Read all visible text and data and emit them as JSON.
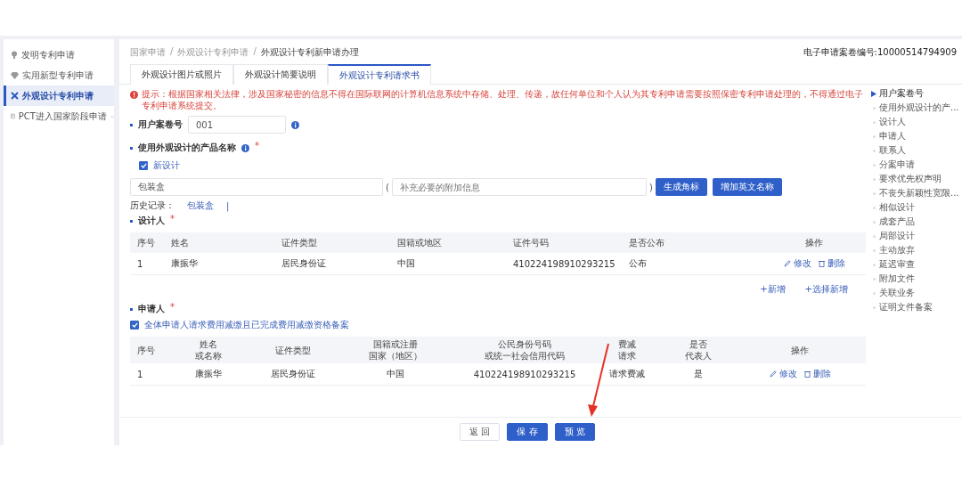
{
  "sidebar": {
    "items": [
      {
        "label": "发明专利申请",
        "selected": false,
        "expandable": false
      },
      {
        "label": "实用新型专利申请",
        "selected": false,
        "expandable": false
      },
      {
        "label": "外观设计专利申请",
        "selected": true,
        "expandable": false
      },
      {
        "label": "PCT进入国家阶段申请",
        "selected": false,
        "expandable": true
      }
    ]
  },
  "breadcrumb": [
    {
      "kind": "link",
      "text": "国家申请"
    },
    {
      "kind": "separator",
      "text": "/"
    },
    {
      "kind": "link",
      "text": "外观设计专利申请"
    },
    {
      "kind": "separator",
      "text": "/"
    },
    {
      "kind": "current",
      "text": "外观设计专利新申请办理"
    }
  ],
  "case_number": "电子申请案卷编号:10000514794909",
  "tabs": [
    {
      "label": "外观设计图片或照片",
      "selected": false
    },
    {
      "label": "外观设计简要说明",
      "selected": false
    },
    {
      "label": "外观设计专利请求书",
      "selected": true
    }
  ],
  "notice": "提示：根据国家相关法律，涉及国家秘密的信息不得在国际联网的计算机信息系统中存储、处理、传递，故任何单位和个人认为其专利申请需要按照保密专利申请处理的，不得通过电子专利申请系统提交。",
  "user_case": {
    "label": "用户案卷号",
    "value": "001"
  },
  "product": {
    "label": "使用外观设计的产品名称",
    "required": true,
    "required_mark": "*",
    "new_design": {
      "label": "新设计",
      "checked": true
    },
    "name": "包装盒",
    "open_paren": "(",
    "extra_placeholder": "补充必要的附加信息",
    "close_paren": ")",
    "buttons": [
      "生成角标",
      "增加英文名称"
    ],
    "history_label": "历史记录：",
    "history": [
      "包装盒"
    ],
    "history_separator": "|"
  },
  "designers": {
    "title": "设计人",
    "required": true,
    "required_mark": "*",
    "columns": [
      "序号",
      "姓名",
      "证件类型",
      "国籍或地区",
      "证件号码",
      "是否公布",
      "操作"
    ],
    "rows": [
      {
        "cells": [
          "1",
          "康振华",
          "居民身份证",
          "中国",
          "410224198910293215",
          "公布"
        ],
        "actions": [
          {
            "label": "修改",
            "kind": "edit"
          },
          {
            "label": "删除",
            "kind": "delete"
          }
        ]
      }
    ],
    "links": [
      "+新增",
      "+选择新增"
    ]
  },
  "applicants": {
    "title": "申请人",
    "required": true,
    "required_mark": "*",
    "fee_reduction": {
      "label": "全体申请人请求费用减缴且已完成费用减缴资格备案",
      "checked": true
    },
    "columns": [
      "序号",
      [
        "姓名",
        "或名称"
      ],
      "证件类型",
      [
        "国籍或注册",
        "国家（地区）"
      ],
      [
        "公民身份号码",
        "或统一社会信用代码"
      ],
      [
        "费减",
        "请求"
      ],
      [
        "是否",
        "代表人"
      ],
      "操作"
    ],
    "rows": [
      {
        "cells": [
          "1",
          "康振华",
          "居民身份证",
          "中国",
          "410224198910293215",
          "请求费减",
          "是"
        ],
        "actions": [
          {
            "label": "修改",
            "kind": "edit"
          },
          {
            "label": "删除",
            "kind": "delete"
          }
        ]
      }
    ]
  },
  "footer_buttons": [
    {
      "label": "返 回",
      "kind": "plain"
    },
    {
      "label": "保 存",
      "kind": "primary"
    },
    {
      "label": "预 览",
      "kind": "primary"
    }
  ],
  "outline": [
    {
      "label": "用户案卷号",
      "selected": true
    },
    {
      "label": "使用外观设计的产...",
      "selected": false
    },
    {
      "label": "设计人",
      "selected": false
    },
    {
      "label": "申请人",
      "selected": false
    },
    {
      "label": "联系人",
      "selected": false
    },
    {
      "label": "分案申请",
      "selected": false
    },
    {
      "label": "要求优先权声明",
      "selected": false
    },
    {
      "label": "不丧失新颖性宽限...",
      "selected": false
    },
    {
      "label": "相似设计",
      "selected": false
    },
    {
      "label": "成套产品",
      "selected": false
    },
    {
      "label": "局部设计",
      "selected": false
    },
    {
      "label": "主动放弃",
      "selected": false
    },
    {
      "label": "延迟审查",
      "selected": false
    },
    {
      "label": "附加文件",
      "selected": false
    },
    {
      "label": "关联业务",
      "selected": false
    },
    {
      "label": "证明文件备案",
      "selected": false
    }
  ]
}
